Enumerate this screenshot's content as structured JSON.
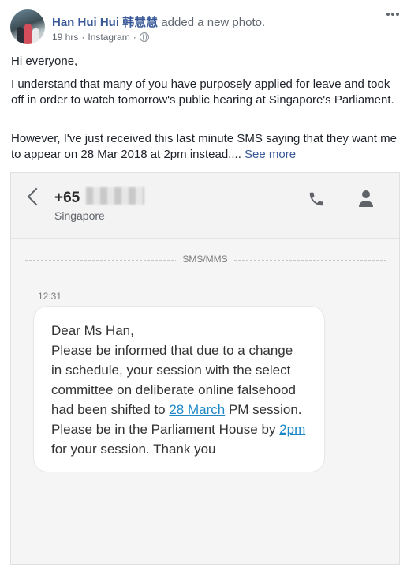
{
  "header": {
    "author": "Han Hui Hui 韩慧慧",
    "action": "added a new photo.",
    "time": "19 hrs",
    "separator": "·",
    "source": "Instagram",
    "separator2": "·"
  },
  "post": {
    "p1": "Hi everyone,",
    "p2": "I understand that many of you have purposely applied for leave and took off in order to watch tomorrow's public hearing at Singapore's Parliament.",
    "p3": "However, I've just received this last minute SMS saying that they want me to appear on 28 Mar 2018 at 2pm instead....",
    "see_more": "See more"
  },
  "sms": {
    "number": "+65",
    "country": "Singapore",
    "label": "SMS/MMS",
    "time": "12:31",
    "msg": {
      "l1": "Dear Ms Han,",
      "l2a": "Please be informed that due to a change in schedule, your session with the select committee on deliberate online falsehood had been shifted to ",
      "link1": "28 March",
      "l2b": " PM session.",
      "l3a": "Please be in the Parliament House by ",
      "link2": "2pm",
      "l3b": " for your session. Thank you"
    }
  },
  "colors": {
    "link": "#385898",
    "sms_link": "#1e88c7"
  }
}
